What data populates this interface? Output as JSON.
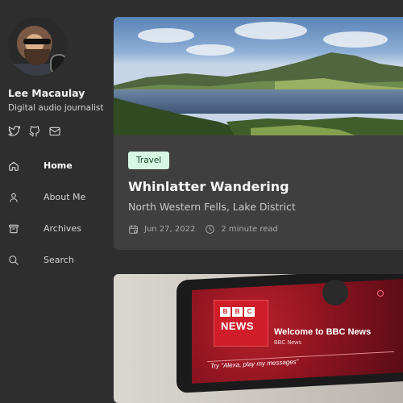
{
  "profile": {
    "name": "Lee Macaulay",
    "role": "Digital audio journalist"
  },
  "social": [
    {
      "icon": "twitter-icon"
    },
    {
      "icon": "github-icon"
    },
    {
      "icon": "mail-icon"
    }
  ],
  "nav": [
    {
      "label": "Home",
      "icon": "home-icon",
      "active": true
    },
    {
      "label": "About Me",
      "icon": "user-icon",
      "active": false
    },
    {
      "label": "Archives",
      "icon": "archive-icon",
      "active": false
    },
    {
      "label": "Search",
      "icon": "search-icon",
      "active": false
    }
  ],
  "post": {
    "tag": "Travel",
    "title": "Whinlatter Wandering",
    "subtitle": "North Western Fells, Lake District",
    "date": "Jun 27, 2022",
    "read_time": "2 minute read"
  },
  "post2_image": {
    "logo_letters": [
      "B",
      "B",
      "C"
    ],
    "logo_word": "NEWS",
    "welcome": "Welcome to BBC News",
    "sub": "BBC News",
    "prompt": "Try \"Alexa, play my messages\""
  },
  "colors": {
    "background": "#2e2e2e",
    "card": "#3f3f3f",
    "tag_bg": "#d6f7e3",
    "tag_text": "#1e4d2f"
  }
}
